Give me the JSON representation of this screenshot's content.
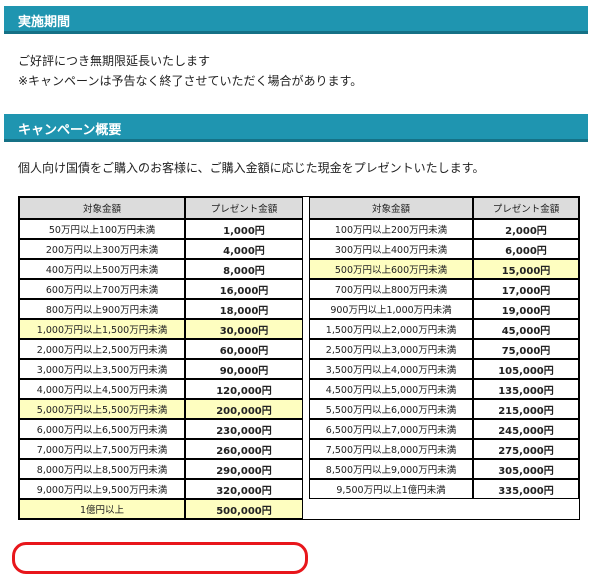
{
  "sections": {
    "period": {
      "heading": "実施期間",
      "lines": [
        "ご好評につき無期限延長いたします",
        "※キャンペーンは予告なく終了させていただく場合があります。"
      ]
    },
    "overview": {
      "heading": "キャンペーン概要",
      "description": "個人向け国債をご購入のお客様に、ご購入金額に応じた現金をプレゼントいたします。"
    }
  },
  "table": {
    "headers": [
      "対象金額",
      "プレゼント金額",
      "対象金額",
      "プレゼント金額"
    ],
    "rows": [
      [
        {
          "t": "50万円以上100万円未満"
        },
        {
          "t": "1,000円"
        },
        {
          "t": "100万円以上200万円未満"
        },
        {
          "t": "2,000円"
        }
      ],
      [
        {
          "t": "200万円以上300万円未満"
        },
        {
          "t": "4,000円"
        },
        {
          "t": "300万円以上400万円未満"
        },
        {
          "t": "6,000円"
        }
      ],
      [
        {
          "t": "400万円以上500万円未満"
        },
        {
          "t": "8,000円"
        },
        {
          "t": "500万円以上600万円未満",
          "hl": true
        },
        {
          "t": "15,000円",
          "hl": true
        }
      ],
      [
        {
          "t": "600万円以上700万円未満"
        },
        {
          "t": "16,000円"
        },
        {
          "t": "700万円以上800万円未満"
        },
        {
          "t": "17,000円"
        }
      ],
      [
        {
          "t": "800万円以上900万円未満"
        },
        {
          "t": "18,000円"
        },
        {
          "t": "900万円以上1,000万円未満"
        },
        {
          "t": "19,000円"
        }
      ],
      [
        {
          "t": "1,000万円以上1,500万円未満",
          "hl": true
        },
        {
          "t": "30,000円",
          "hl": true
        },
        {
          "t": "1,500万円以上2,000万円未満"
        },
        {
          "t": "45,000円"
        }
      ],
      [
        {
          "t": "2,000万円以上2,500万円未満"
        },
        {
          "t": "60,000円"
        },
        {
          "t": "2,500万円以上3,000万円未満"
        },
        {
          "t": "75,000円"
        }
      ],
      [
        {
          "t": "3,000万円以上3,500万円未満"
        },
        {
          "t": "90,000円"
        },
        {
          "t": "3,500万円以上4,000万円未満"
        },
        {
          "t": "105,000円"
        }
      ],
      [
        {
          "t": "4,000万円以上4,500万円未満"
        },
        {
          "t": "120,000円"
        },
        {
          "t": "4,500万円以上5,000万円未満"
        },
        {
          "t": "135,000円"
        }
      ],
      [
        {
          "t": "5,000万円以上5,500万円未満",
          "hl": true
        },
        {
          "t": "200,000円",
          "hl": true
        },
        {
          "t": "5,500万円以上6,000万円未満"
        },
        {
          "t": "215,000円"
        }
      ],
      [
        {
          "t": "6,000万円以上6,500万円未満"
        },
        {
          "t": "230,000円"
        },
        {
          "t": "6,500万円以上7,000万円未満"
        },
        {
          "t": "245,000円"
        }
      ],
      [
        {
          "t": "7,000万円以上7,500万円未満"
        },
        {
          "t": "260,000円"
        },
        {
          "t": "7,500万円以上8,000万円未満"
        },
        {
          "t": "275,000円"
        }
      ],
      [
        {
          "t": "8,000万円以上8,500万円未満"
        },
        {
          "t": "290,000円"
        },
        {
          "t": "8,500万円以上9,000万円未満"
        },
        {
          "t": "305,000円"
        }
      ],
      [
        {
          "t": "9,000万円以上9,500万円未満"
        },
        {
          "t": "320,000円"
        },
        {
          "t": "9,500万円以上1億円未満"
        },
        {
          "t": "335,000円"
        }
      ],
      [
        {
          "t": "1億円以上",
          "hl": true
        },
        {
          "t": "500,000円",
          "hl": true
        }
      ]
    ]
  },
  "colors": {
    "section_bar": "#1f95b0",
    "highlight": "#fefec0",
    "header_bg": "#dcdcdc",
    "circle_annotation": "#e8161b"
  }
}
